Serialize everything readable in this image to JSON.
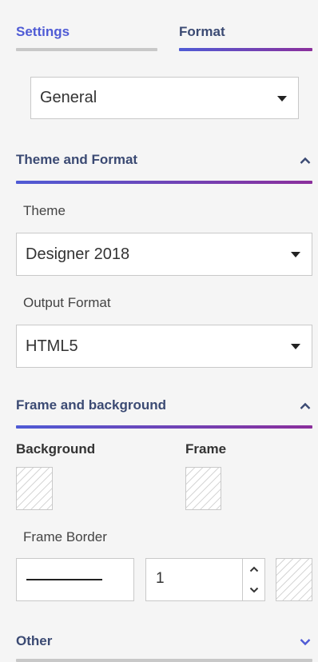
{
  "tabs": {
    "settings": "Settings",
    "format": "Format"
  },
  "general_select": {
    "value": "General"
  },
  "theme_section": {
    "title": "Theme and Format",
    "theme_label": "Theme",
    "theme_value": "Designer 2018",
    "output_label": "Output Format",
    "output_value": "HTML5"
  },
  "frame_section": {
    "title": "Frame and background",
    "background_label": "Background",
    "frame_label": "Frame",
    "frame_border_label": "Frame Border",
    "border_width": "1"
  },
  "other_section": {
    "title": "Other"
  },
  "colors": {
    "accent_start": "#4f5bd5",
    "accent_end": "#8b2f9c",
    "section_title": "#3b4a73",
    "background": "#f5f5f5"
  },
  "icons": {
    "select_caret": "caret-down-icon",
    "section_expanded": "chevron-up-icon",
    "section_collapsed": "chevron-down-icon",
    "stepper_up": "chevron-up-icon",
    "stepper_down": "chevron-down-icon"
  }
}
